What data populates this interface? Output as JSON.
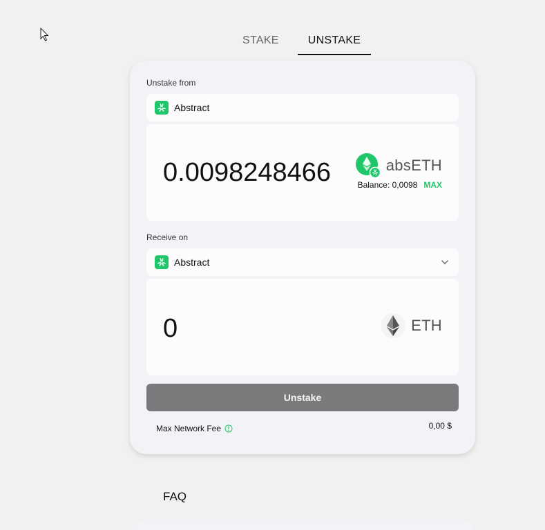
{
  "tabs": {
    "stake": "STAKE",
    "unstake": "UNSTAKE",
    "active": "unstake"
  },
  "from": {
    "label": "Unstake from",
    "network": "Abstract",
    "amount": "0.0098248466",
    "token": "absETH",
    "balance_label": "Balance: 0,0098",
    "max_label": "MAX"
  },
  "to": {
    "label": "Receive on",
    "network": "Abstract",
    "amount": "0",
    "token": "ETH"
  },
  "action": {
    "unstake_label": "Unstake"
  },
  "fee": {
    "label": "Max Network Fee",
    "value": "0,00 $"
  },
  "faq": {
    "title": "FAQ"
  },
  "colors": {
    "accent": "#1fc76a",
    "button_disabled": "#7a7a7c",
    "card_bg": "#f1f3f6",
    "page_bg": "#f3f1ef"
  },
  "icons": {
    "network": "abstract-logo-icon",
    "abseth": "abseth-token-icon",
    "eth": "eth-diamond-icon",
    "dropdown": "chevron-down-icon",
    "info": "info-icon"
  }
}
